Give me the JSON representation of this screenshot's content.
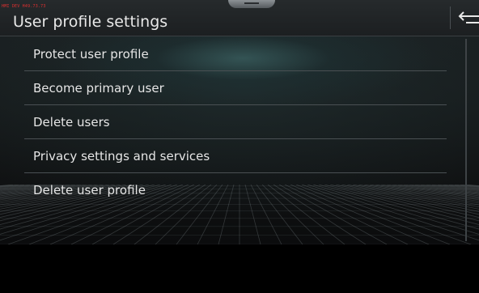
{
  "status": {
    "debug_label": "HMI DEV H49.73.73"
  },
  "header": {
    "title": "User profile settings",
    "back_icon": "back-arrow-icon"
  },
  "menu": {
    "items": [
      {
        "label": "Protect user profile"
      },
      {
        "label": "Become primary user"
      },
      {
        "label": "Delete users"
      },
      {
        "label": "Privacy settings and services"
      },
      {
        "label": "Delete user profile"
      }
    ]
  },
  "colors": {
    "background": "#000000",
    "header_bg": "#22262a",
    "text": "#e6e6e6",
    "debug_text": "#e03030",
    "separator": "#4a5053"
  }
}
